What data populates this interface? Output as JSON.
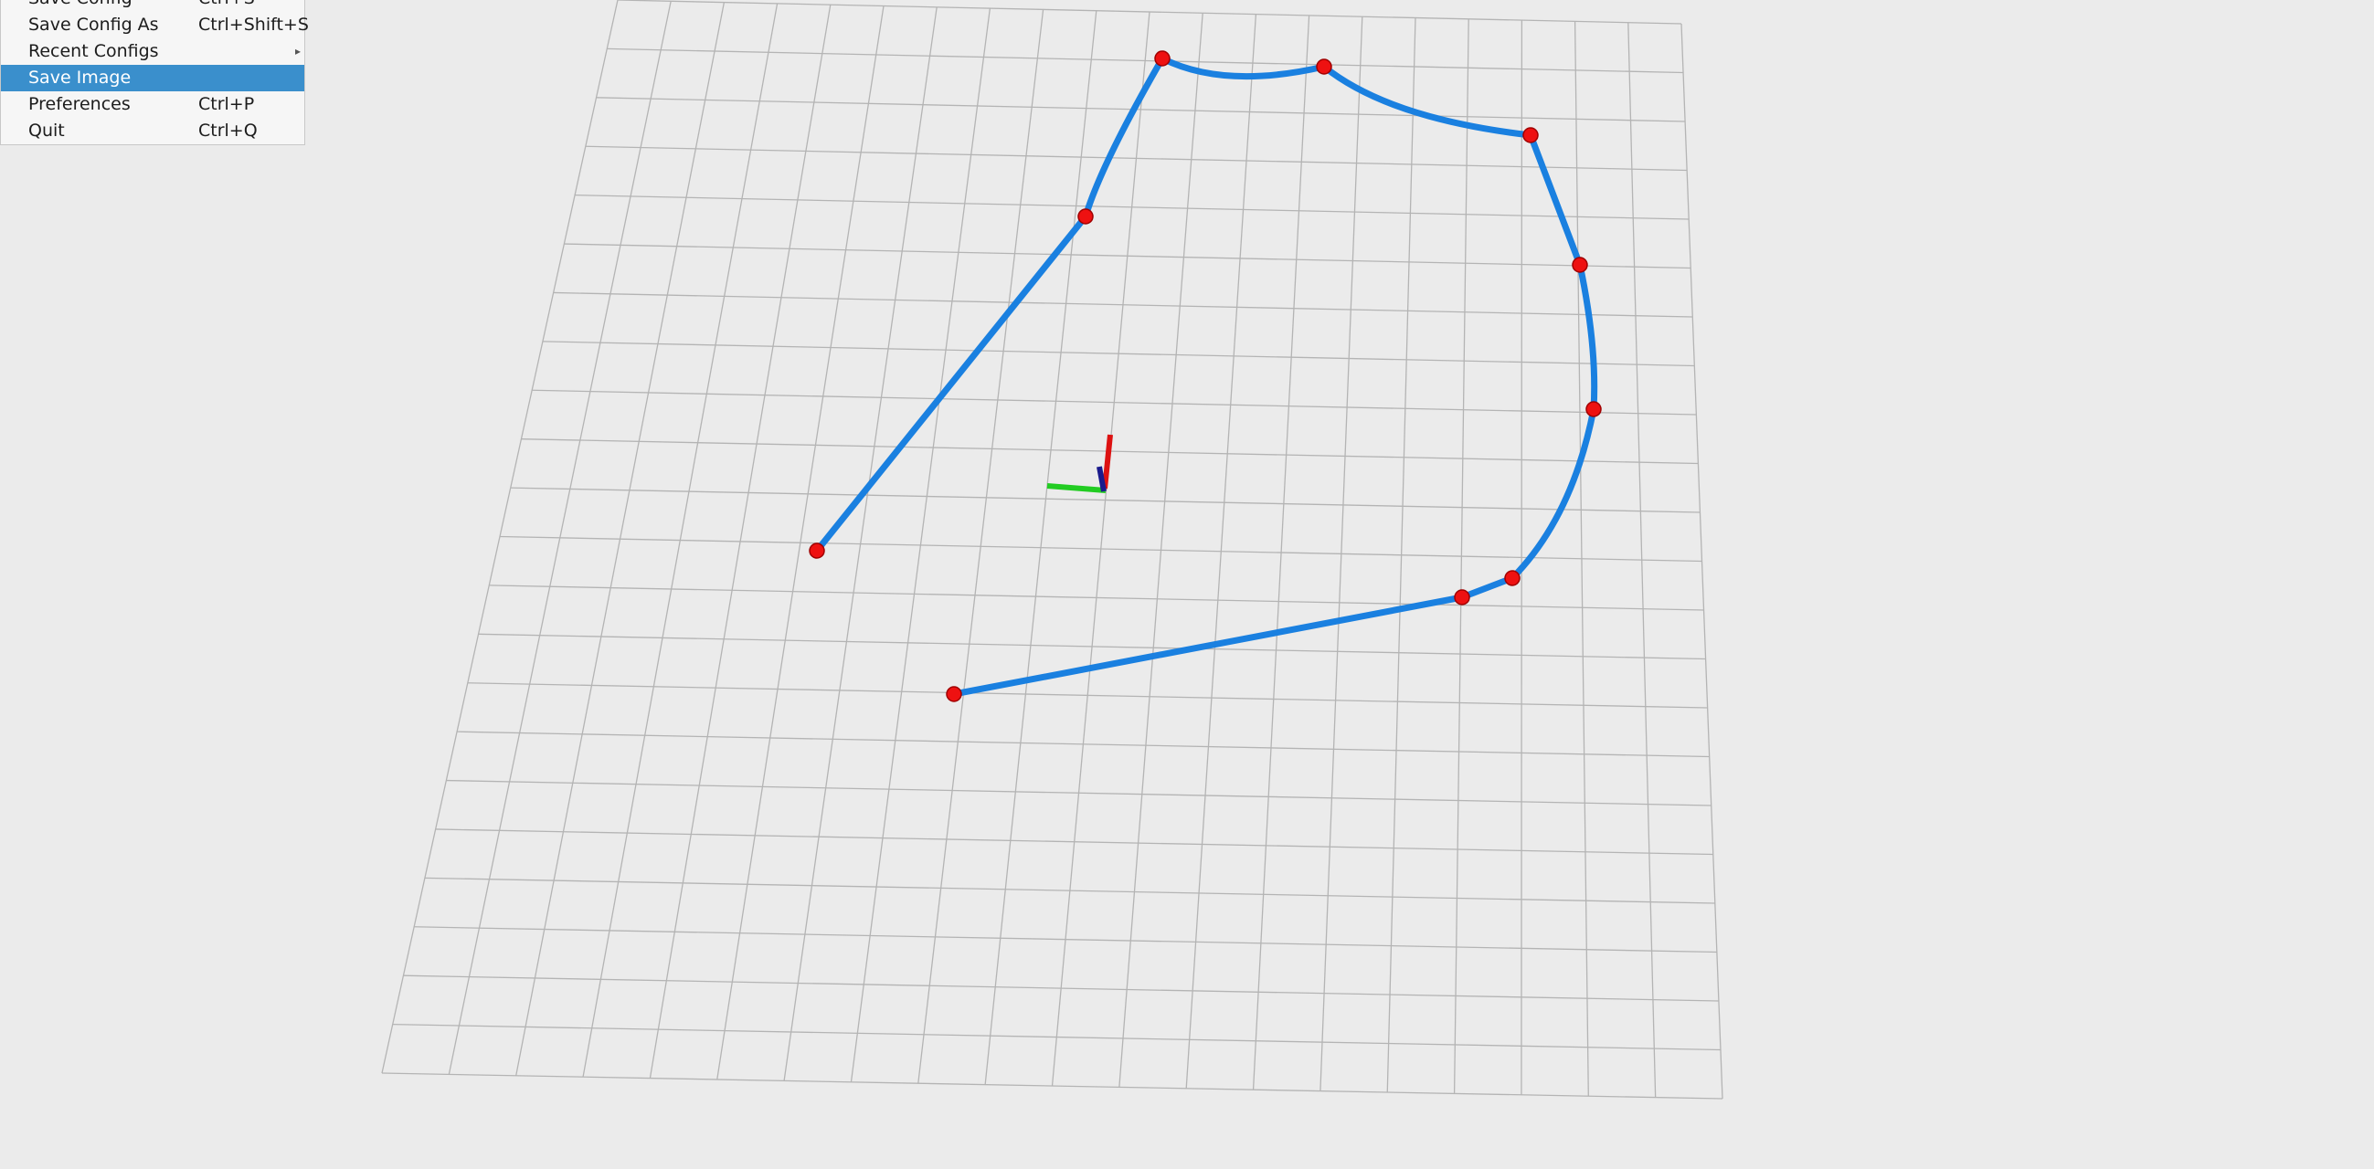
{
  "menu": {
    "items": [
      {
        "label": "Save Config",
        "shortcut": "Ctrl+S",
        "highlighted": false,
        "submenu": false
      },
      {
        "label": "Save Config As",
        "shortcut": "Ctrl+Shift+S",
        "highlighted": false,
        "submenu": false
      },
      {
        "label": "Recent Configs",
        "shortcut": "",
        "highlighted": false,
        "submenu": true
      },
      {
        "label": "Save Image",
        "shortcut": "",
        "highlighted": true,
        "submenu": false
      },
      {
        "label": "Preferences",
        "shortcut": "Ctrl+P",
        "highlighted": false,
        "submenu": false
      },
      {
        "label": "Quit",
        "shortcut": "Ctrl+Q",
        "highlighted": false,
        "submenu": false
      }
    ],
    "submenu_icon": "chevron-right-icon"
  },
  "viewport": {
    "background_color": "#ebebeb",
    "grid_color": "#b4b4b4",
    "path_color": "#1a80e0",
    "waypoint_color": "#ee1111",
    "axis_colors": {
      "x": "#dd1111",
      "y": "#22cc22",
      "z": "#1a1a8c"
    }
  }
}
